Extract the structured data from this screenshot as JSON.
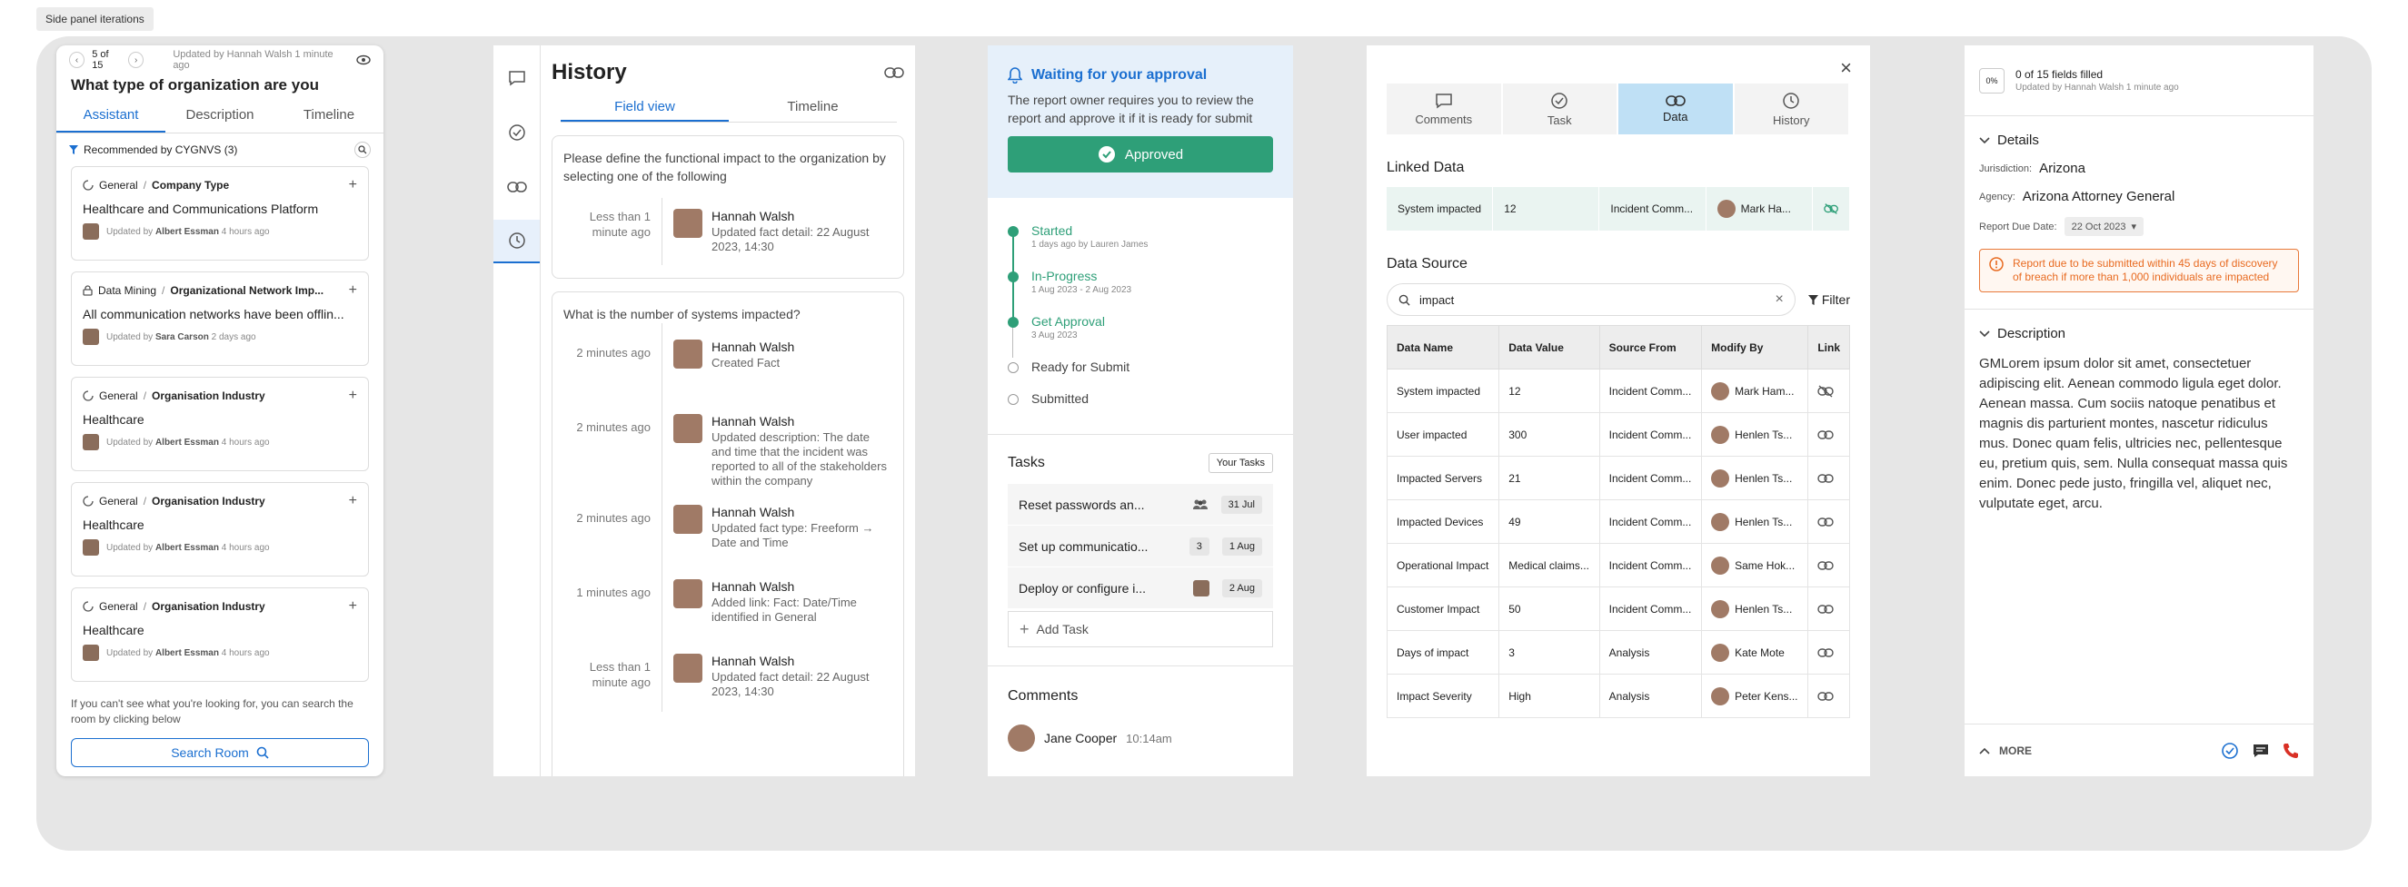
{
  "tag": "Side panel iterations",
  "p1": {
    "pager": "5 of 15",
    "updated": "Updated by Hannah Walsh 1 minute ago",
    "title": "What type of organization are you",
    "tabs": [
      "Assistant",
      "Description",
      "Timeline"
    ],
    "recommended": "Recommended by CYGNVS (3)",
    "cards": [
      {
        "cat": "General",
        "sub": "Company Type",
        "value": "Healthcare and Communications Platform",
        "by": "Albert Essman",
        "when": "4 hours ago",
        "lock": false
      },
      {
        "cat": "Data Mining",
        "sub": "Organizational Network Imp...",
        "value": "All communication networks have been offlin...",
        "by": "Sara Carson",
        "when": "2 days ago",
        "lock": true
      },
      {
        "cat": "General",
        "sub": "Organisation Industry",
        "value": "Healthcare",
        "by": "Albert Essman",
        "when": "4 hours ago",
        "lock": false
      },
      {
        "cat": "General",
        "sub": "Organisation Industry",
        "value": "Healthcare",
        "by": "Albert Essman",
        "when": "4 hours ago",
        "lock": false
      },
      {
        "cat": "General",
        "sub": "Organisation Industry",
        "value": "Healthcare",
        "by": "Albert Essman",
        "when": "4 hours ago",
        "lock": false
      }
    ],
    "updated_by_prefix": "Updated by",
    "hint": "If you can't see what you're looking for, you can search the room by clicking below",
    "search_button": "Search Room"
  },
  "p2": {
    "title": "History",
    "tabs": [
      "Field view",
      "Timeline"
    ],
    "q1": "Please define the functional impact to the organization by selecting one of the following",
    "e1": {
      "time": "Less than 1 minute ago",
      "name": "Hannah Walsh",
      "detail": "Updated fact detail: 22 August 2023, 14:30"
    },
    "q2": "What is the number of systems impacted?",
    "entries": [
      {
        "time": "2 minutes ago",
        "name": "Hannah Walsh",
        "detail": "Created Fact"
      },
      {
        "time": "2 minutes ago",
        "name": "Hannah Walsh",
        "detail": "Updated description: The date and time that the incident was reported to all of the stakeholders within the company"
      },
      {
        "time": "2 minutes ago",
        "name": "Hannah Walsh",
        "detail": "Updated fact type: Freeform → Date and Time"
      },
      {
        "time": "1 minutes ago",
        "name": "Hannah Walsh",
        "detail": "Added link: Fact: Date/Time identified in General"
      },
      {
        "time": "Less than 1 minute ago",
        "name": "Hannah Walsh",
        "detail": "Updated fact detail: 22 August 2023, 14:30"
      }
    ]
  },
  "p3": {
    "title": "Waiting for your approval",
    "desc": "The report owner requires you to review the report and approve it if it is ready for submit",
    "approved": "Approved",
    "steps": [
      {
        "name": "Started",
        "date": "1 days ago by Lauren James",
        "done": true
      },
      {
        "name": "In-Progress",
        "date": "1 Aug 2023 - 2 Aug 2023",
        "done": true
      },
      {
        "name": "Get Approval",
        "date": "3 Aug 2023",
        "done": true
      },
      {
        "name": "Ready for Submit",
        "date": "",
        "done": false
      },
      {
        "name": "Submitted",
        "date": "",
        "done": false
      }
    ],
    "tasks_title": "Tasks",
    "your_tasks": "Your Tasks",
    "tasks": [
      {
        "name": "Reset passwords an...",
        "badge": "",
        "date": "31 Jul",
        "icon": "group"
      },
      {
        "name": "Set up communicatio...",
        "badge": "3",
        "date": "1 Aug",
        "icon": ""
      },
      {
        "name": "Deploy or configure i...",
        "badge": "",
        "date": "2 Aug",
        "icon": "avatar"
      }
    ],
    "add_task": "Add Task",
    "comments_title": "Comments",
    "comment_name": "Jane Cooper",
    "comment_time": "10:14am"
  },
  "p4": {
    "tabs": [
      "Comments",
      "Task",
      "Data",
      "History"
    ],
    "linked_title": "Linked Data",
    "linked": {
      "name": "System impacted",
      "value": "12",
      "source": "Incident Comm...",
      "by": "Mark Ha..."
    },
    "source_title": "Data Source",
    "search_value": "impact",
    "filter": "Filter",
    "columns": [
      "Data Name",
      "Data Value",
      "Source From",
      "Modify By",
      "Link"
    ],
    "rows": [
      {
        "name": "System impacted",
        "value": "12",
        "source": "Incident Comm...",
        "by": "Mark Ham...",
        "linked": false
      },
      {
        "name": "User impacted",
        "value": "300",
        "source": "Incident Comm...",
        "by": "Henlen Ts...",
        "linked": true
      },
      {
        "name": "Impacted Servers",
        "value": "21",
        "source": "Incident Comm...",
        "by": "Henlen Ts...",
        "linked": true
      },
      {
        "name": "Impacted Devices",
        "value": "49",
        "source": "Incident Comm...",
        "by": "Henlen Ts...",
        "linked": true
      },
      {
        "name": "Operational Impact",
        "value": "Medical claims...",
        "source": "Incident Comm...",
        "by": "Same Hok...",
        "linked": true
      },
      {
        "name": "Customer Impact",
        "value": "50",
        "source": "Incident Comm...",
        "by": "Henlen Ts...",
        "linked": true
      },
      {
        "name": "Days of impact",
        "value": "3",
        "source": "Analysis",
        "by": "Kate Mote",
        "linked": true
      },
      {
        "name": "Impact Severity",
        "value": "High",
        "source": "Analysis",
        "by": "Peter Kens...",
        "linked": true
      }
    ]
  },
  "p5": {
    "pct": "0%",
    "filled": "0 of 15 fields filled",
    "updated": "Updated by Hannah Walsh 1 minute ago",
    "details": "Details",
    "jur_label": "Jurisdiction:",
    "jur": "Arizona",
    "agency_label": "Agency:",
    "agency": "Arizona Attorney General",
    "due_label": "Report Due Date:",
    "due": "22 Oct 2023",
    "warning": "Report due to be submitted within 45 days of discovery of breach if more than 1,000 individuals are impacted",
    "desc_title": "Description",
    "desc": "GMLorem ipsum dolor sit amet, consectetuer adipiscing elit. Aenean commodo ligula eget dolor. Aenean massa. Cum sociis natoque penatibus et magnis dis parturient montes, nascetur ridiculus mus. Donec quam felis, ultricies nec, pellentesque eu, pretium quis, sem. Nulla consequat massa quis enim. Donec pede justo, fringilla vel, aliquet nec, vulputate eget, arcu.",
    "more": "MORE"
  },
  "colors": {
    "accent": "#1b6fd0",
    "green": "#2e9f78",
    "warn": "#e86a20"
  }
}
